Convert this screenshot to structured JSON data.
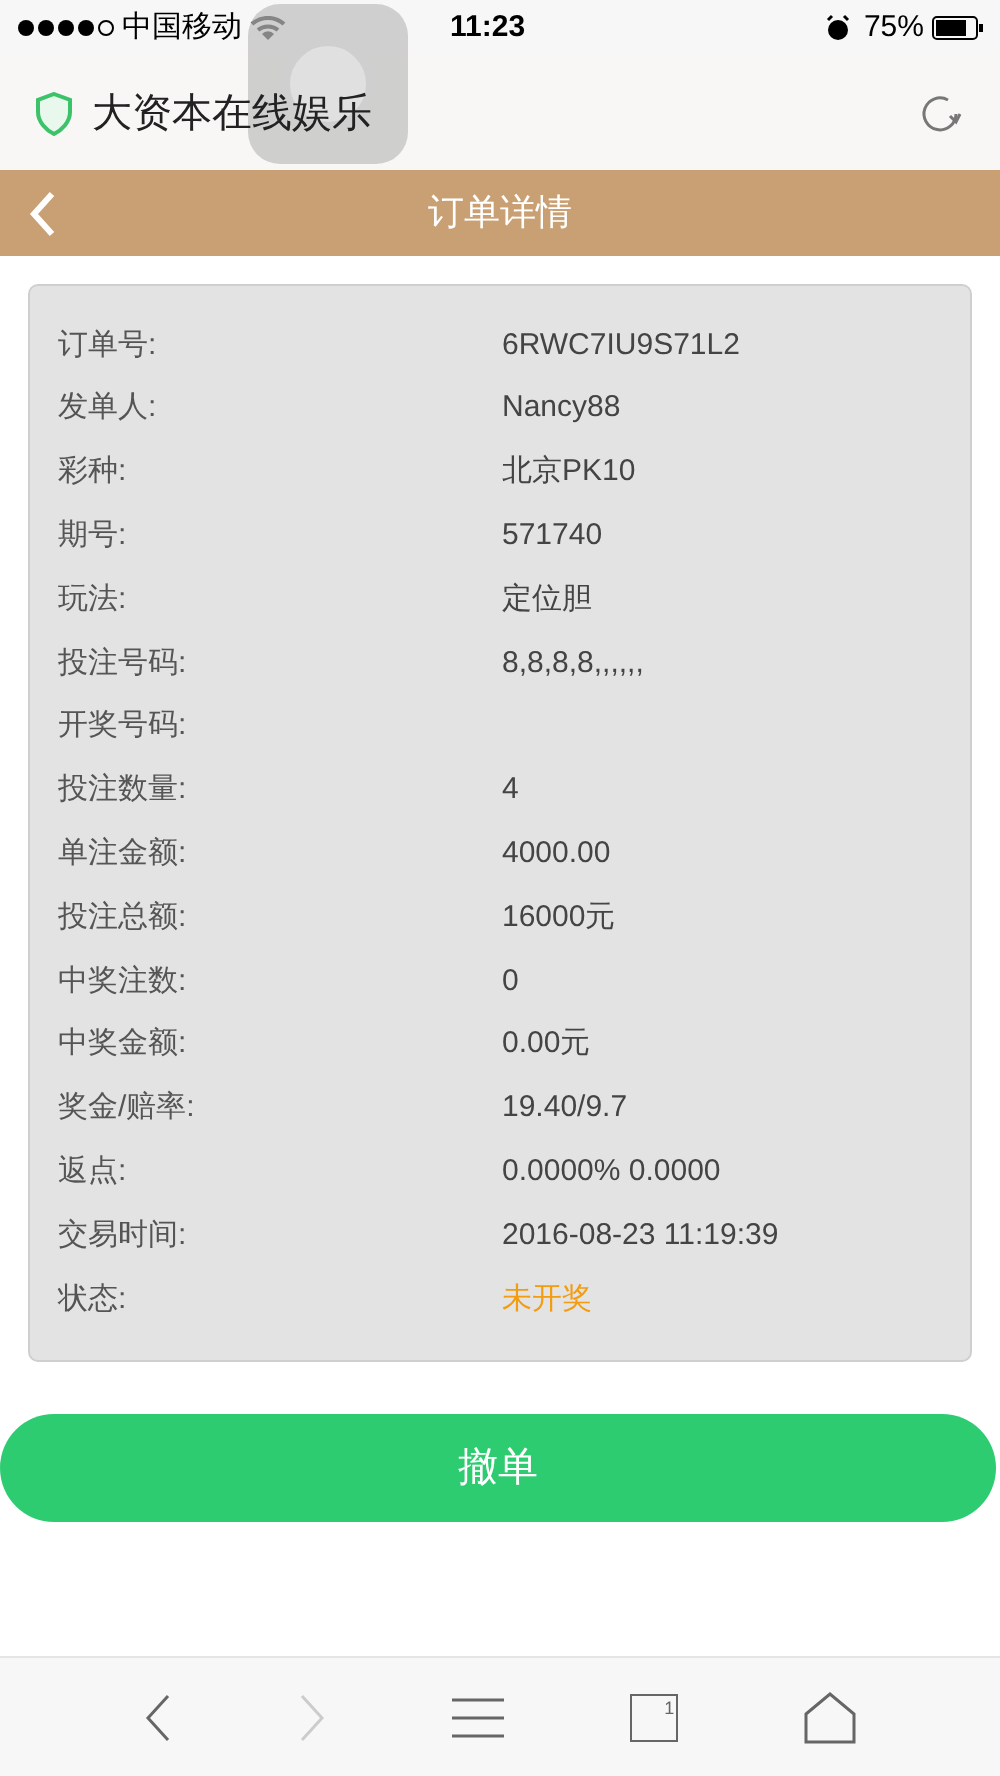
{
  "status_bar": {
    "carrier": "中国移动",
    "time": "11:23",
    "battery": "75%"
  },
  "browser": {
    "site_title": "大资本在线娱乐"
  },
  "header": {
    "title": "订单详情"
  },
  "details": [
    {
      "label": "订单号:",
      "value": "6RWC7IU9S71L2",
      "kind": "plain"
    },
    {
      "label": "发单人:",
      "value": "Nancy88",
      "kind": "plain"
    },
    {
      "label": "彩种:",
      "value": "北京PK10",
      "kind": "plain"
    },
    {
      "label": "期号:",
      "value": "571740",
      "kind": "plain"
    },
    {
      "label": "玩法:",
      "value": "定位胆",
      "kind": "plain"
    },
    {
      "label": "投注号码:",
      "value": "8,8,8,8,,,,,,",
      "kind": "plain"
    },
    {
      "label": "开奖号码:",
      "kind": "plain"
    },
    {
      "label": "投注数量:",
      "value": "4",
      "kind": "plain"
    },
    {
      "label": "单注金额:",
      "value": "4000.00",
      "kind": "plain"
    },
    {
      "label": "投注总额:",
      "value": "16000元",
      "kind": "plain"
    },
    {
      "label": "中奖注数:",
      "value": "0",
      "kind": "plain"
    },
    {
      "label": "中奖金额:",
      "value": "0.00元",
      "kind": "plain"
    },
    {
      "label": "奖金/赔率:",
      "value": "19.40/9.7",
      "kind": "plain"
    },
    {
      "label": "返点:",
      "value": "0.0000% 0.0000",
      "kind": "plain"
    },
    {
      "label": "交易时间:",
      "value": "2016-08-23 11:19:39",
      "kind": "plain"
    },
    {
      "label": "状态:",
      "value": "未开奖",
      "kind": "status"
    }
  ],
  "cancel_button": "撤单",
  "toolbar": {
    "forward_disabled": true,
    "tab_count": "1"
  }
}
